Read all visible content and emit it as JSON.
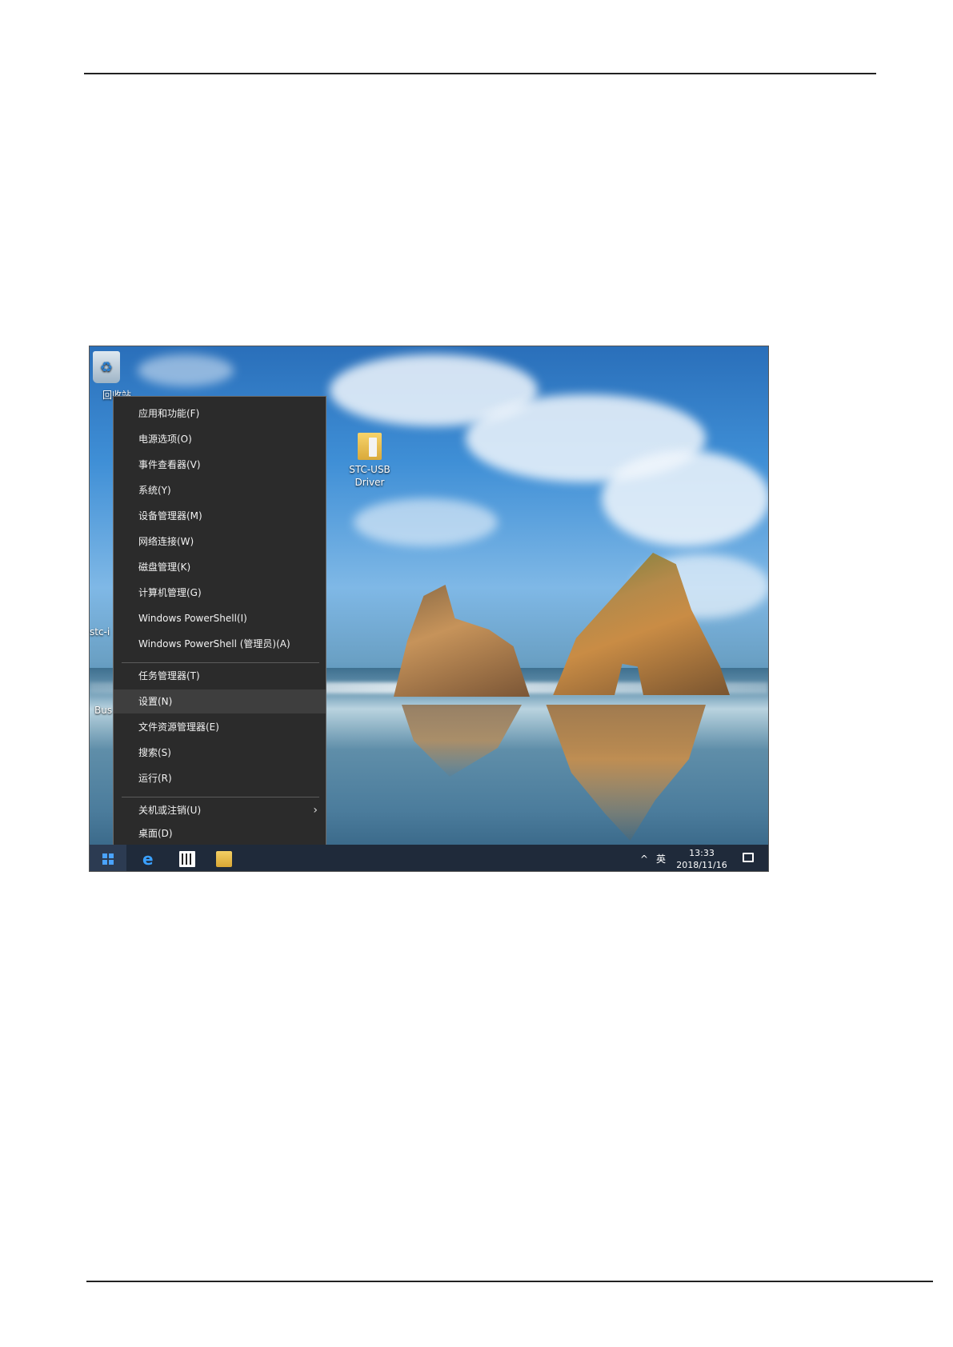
{
  "desktop": {
    "icons": [
      {
        "label": "回收站"
      },
      {
        "label": "STC-USB\nDriver"
      },
      {
        "label": "stc-i"
      },
      {
        "label": "Bus"
      }
    ]
  },
  "context_menu": {
    "items": [
      {
        "label": "应用和功能(F)"
      },
      {
        "label": "电源选项(O)"
      },
      {
        "label": "事件查看器(V)"
      },
      {
        "label": "系统(Y)"
      },
      {
        "label": "设备管理器(M)"
      },
      {
        "label": "网络连接(W)"
      },
      {
        "label": "磁盘管理(K)"
      },
      {
        "label": "计算机管理(G)"
      },
      {
        "label": "Windows PowerShell(I)"
      },
      {
        "label": "Windows PowerShell (管理员)(A)"
      },
      {
        "label": "任务管理器(T)"
      },
      {
        "label": "设置(N)"
      },
      {
        "label": "文件资源管理器(E)"
      },
      {
        "label": "搜索(S)"
      },
      {
        "label": "运行(R)"
      },
      {
        "label": "关机或注销(U)"
      },
      {
        "label": "桌面(D)"
      }
    ],
    "active_item": "设置(N)"
  },
  "taskbar": {
    "tray_chevron": "^",
    "input_method": "英",
    "time": "13:33",
    "date": "2018/11/16",
    "icons": [
      "windows-start-icon",
      "edge-icon",
      "calculator-icon",
      "file-explorer-icon",
      "action-center-icon"
    ]
  }
}
